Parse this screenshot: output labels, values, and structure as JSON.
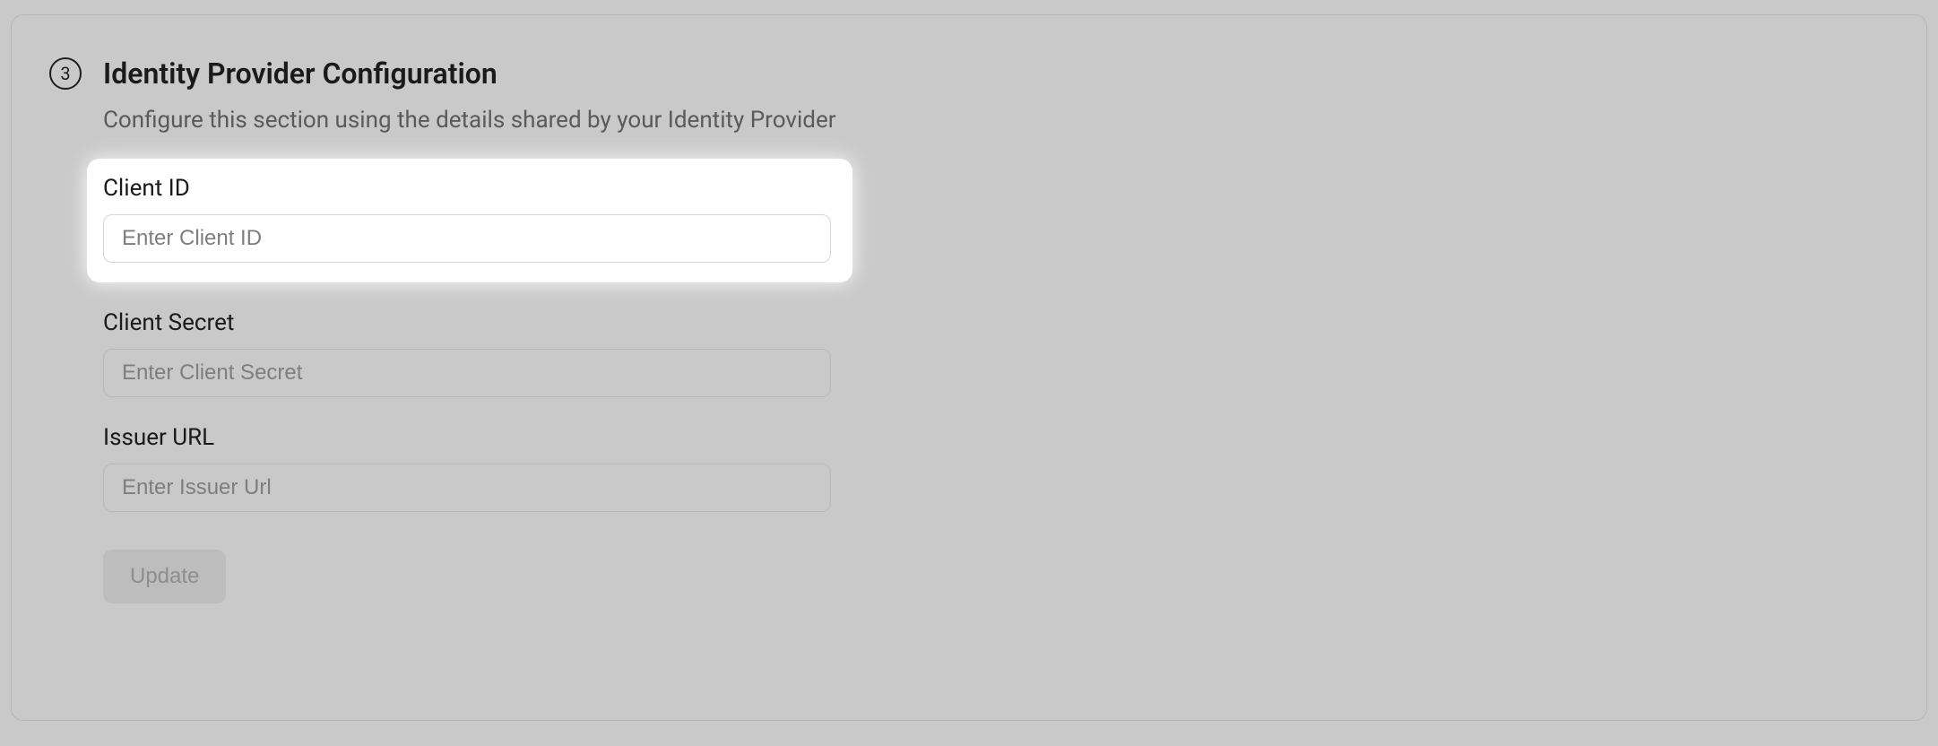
{
  "step": {
    "number": "3",
    "title": "Identity Provider Configuration",
    "subtitle": "Configure this section using the details shared by your Identity Provider"
  },
  "fields": {
    "clientId": {
      "label": "Client ID",
      "placeholder": "Enter Client ID",
      "value": ""
    },
    "clientSecret": {
      "label": "Client Secret",
      "placeholder": "Enter Client Secret",
      "value": ""
    },
    "issuerUrl": {
      "label": "Issuer URL",
      "placeholder": "Enter Issuer Url",
      "value": ""
    }
  },
  "actions": {
    "update": "Update"
  }
}
